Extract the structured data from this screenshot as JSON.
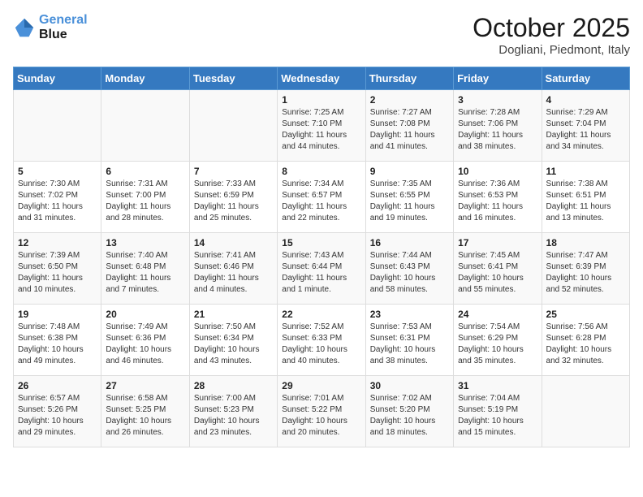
{
  "header": {
    "logo_line1": "General",
    "logo_line2": "Blue",
    "month": "October 2025",
    "location": "Dogliani, Piedmont, Italy"
  },
  "weekdays": [
    "Sunday",
    "Monday",
    "Tuesday",
    "Wednesday",
    "Thursday",
    "Friday",
    "Saturday"
  ],
  "weeks": [
    [
      {
        "day": "",
        "info": ""
      },
      {
        "day": "",
        "info": ""
      },
      {
        "day": "",
        "info": ""
      },
      {
        "day": "1",
        "info": "Sunrise: 7:25 AM\nSunset: 7:10 PM\nDaylight: 11 hours\nand 44 minutes."
      },
      {
        "day": "2",
        "info": "Sunrise: 7:27 AM\nSunset: 7:08 PM\nDaylight: 11 hours\nand 41 minutes."
      },
      {
        "day": "3",
        "info": "Sunrise: 7:28 AM\nSunset: 7:06 PM\nDaylight: 11 hours\nand 38 minutes."
      },
      {
        "day": "4",
        "info": "Sunrise: 7:29 AM\nSunset: 7:04 PM\nDaylight: 11 hours\nand 34 minutes."
      }
    ],
    [
      {
        "day": "5",
        "info": "Sunrise: 7:30 AM\nSunset: 7:02 PM\nDaylight: 11 hours\nand 31 minutes."
      },
      {
        "day": "6",
        "info": "Sunrise: 7:31 AM\nSunset: 7:00 PM\nDaylight: 11 hours\nand 28 minutes."
      },
      {
        "day": "7",
        "info": "Sunrise: 7:33 AM\nSunset: 6:59 PM\nDaylight: 11 hours\nand 25 minutes."
      },
      {
        "day": "8",
        "info": "Sunrise: 7:34 AM\nSunset: 6:57 PM\nDaylight: 11 hours\nand 22 minutes."
      },
      {
        "day": "9",
        "info": "Sunrise: 7:35 AM\nSunset: 6:55 PM\nDaylight: 11 hours\nand 19 minutes."
      },
      {
        "day": "10",
        "info": "Sunrise: 7:36 AM\nSunset: 6:53 PM\nDaylight: 11 hours\nand 16 minutes."
      },
      {
        "day": "11",
        "info": "Sunrise: 7:38 AM\nSunset: 6:51 PM\nDaylight: 11 hours\nand 13 minutes."
      }
    ],
    [
      {
        "day": "12",
        "info": "Sunrise: 7:39 AM\nSunset: 6:50 PM\nDaylight: 11 hours\nand 10 minutes."
      },
      {
        "day": "13",
        "info": "Sunrise: 7:40 AM\nSunset: 6:48 PM\nDaylight: 11 hours\nand 7 minutes."
      },
      {
        "day": "14",
        "info": "Sunrise: 7:41 AM\nSunset: 6:46 PM\nDaylight: 11 hours\nand 4 minutes."
      },
      {
        "day": "15",
        "info": "Sunrise: 7:43 AM\nSunset: 6:44 PM\nDaylight: 11 hours\nand 1 minute."
      },
      {
        "day": "16",
        "info": "Sunrise: 7:44 AM\nSunset: 6:43 PM\nDaylight: 10 hours\nand 58 minutes."
      },
      {
        "day": "17",
        "info": "Sunrise: 7:45 AM\nSunset: 6:41 PM\nDaylight: 10 hours\nand 55 minutes."
      },
      {
        "day": "18",
        "info": "Sunrise: 7:47 AM\nSunset: 6:39 PM\nDaylight: 10 hours\nand 52 minutes."
      }
    ],
    [
      {
        "day": "19",
        "info": "Sunrise: 7:48 AM\nSunset: 6:38 PM\nDaylight: 10 hours\nand 49 minutes."
      },
      {
        "day": "20",
        "info": "Sunrise: 7:49 AM\nSunset: 6:36 PM\nDaylight: 10 hours\nand 46 minutes."
      },
      {
        "day": "21",
        "info": "Sunrise: 7:50 AM\nSunset: 6:34 PM\nDaylight: 10 hours\nand 43 minutes."
      },
      {
        "day": "22",
        "info": "Sunrise: 7:52 AM\nSunset: 6:33 PM\nDaylight: 10 hours\nand 40 minutes."
      },
      {
        "day": "23",
        "info": "Sunrise: 7:53 AM\nSunset: 6:31 PM\nDaylight: 10 hours\nand 38 minutes."
      },
      {
        "day": "24",
        "info": "Sunrise: 7:54 AM\nSunset: 6:29 PM\nDaylight: 10 hours\nand 35 minutes."
      },
      {
        "day": "25",
        "info": "Sunrise: 7:56 AM\nSunset: 6:28 PM\nDaylight: 10 hours\nand 32 minutes."
      }
    ],
    [
      {
        "day": "26",
        "info": "Sunrise: 6:57 AM\nSunset: 5:26 PM\nDaylight: 10 hours\nand 29 minutes."
      },
      {
        "day": "27",
        "info": "Sunrise: 6:58 AM\nSunset: 5:25 PM\nDaylight: 10 hours\nand 26 minutes."
      },
      {
        "day": "28",
        "info": "Sunrise: 7:00 AM\nSunset: 5:23 PM\nDaylight: 10 hours\nand 23 minutes."
      },
      {
        "day": "29",
        "info": "Sunrise: 7:01 AM\nSunset: 5:22 PM\nDaylight: 10 hours\nand 20 minutes."
      },
      {
        "day": "30",
        "info": "Sunrise: 7:02 AM\nSunset: 5:20 PM\nDaylight: 10 hours\nand 18 minutes."
      },
      {
        "day": "31",
        "info": "Sunrise: 7:04 AM\nSunset: 5:19 PM\nDaylight: 10 hours\nand 15 minutes."
      },
      {
        "day": "",
        "info": ""
      }
    ]
  ]
}
